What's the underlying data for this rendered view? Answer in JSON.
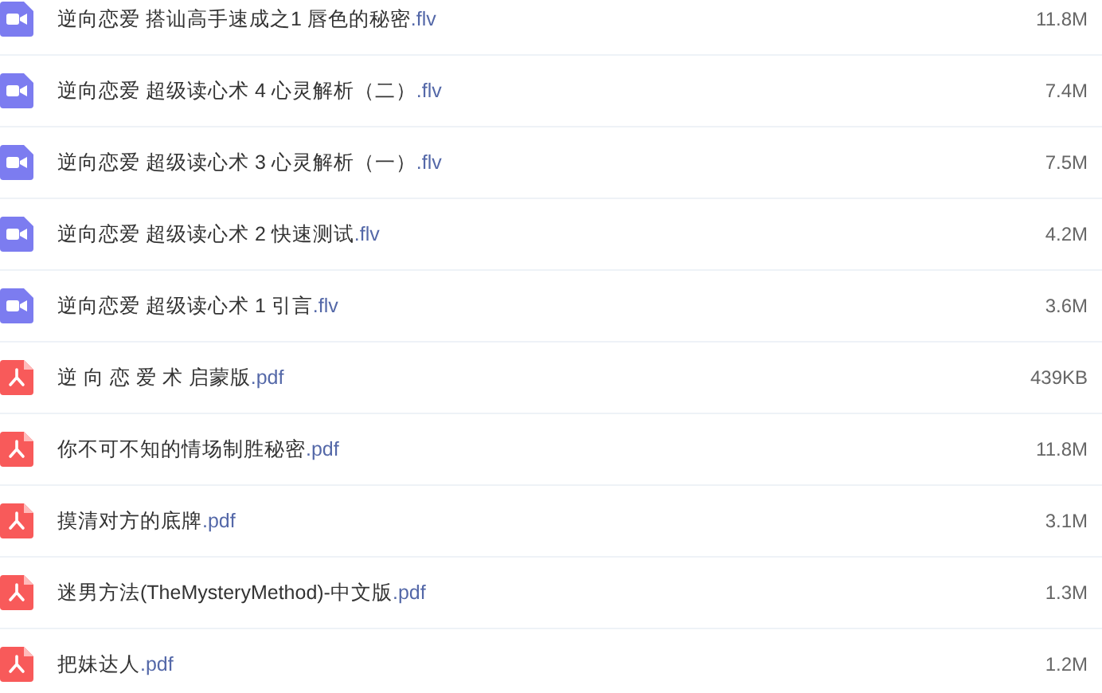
{
  "files": [
    {
      "kind": "video",
      "name": "逆向恋爱 搭讪高手速成之1 唇色的秘密",
      "extension": ".flv",
      "size": "11.8M"
    },
    {
      "kind": "video",
      "name": "逆向恋爱 超级读心术 4 心灵解析（二）",
      "extension": ".flv",
      "size": "7.4M"
    },
    {
      "kind": "video",
      "name": "逆向恋爱 超级读心术 3 心灵解析（一）",
      "extension": ".flv",
      "size": "7.5M"
    },
    {
      "kind": "video",
      "name": "逆向恋爱 超级读心术 2 快速测试",
      "extension": ".flv",
      "size": "4.2M"
    },
    {
      "kind": "video",
      "name": "逆向恋爱 超级读心术 1 引言",
      "extension": ".flv",
      "size": "3.6M"
    },
    {
      "kind": "pdf",
      "name": "逆 向 恋 爱 术 启蒙版",
      "extension": ".pdf",
      "size": "439KB"
    },
    {
      "kind": "pdf",
      "name": "你不可不知的情场制胜秘密",
      "extension": ".pdf",
      "size": "11.8M"
    },
    {
      "kind": "pdf",
      "name": "摸清对方的底牌",
      "extension": ".pdf",
      "size": "3.1M"
    },
    {
      "kind": "pdf",
      "name": "迷男方法(TheMysteryMethod)-中文版",
      "extension": ".pdf",
      "size": "1.3M"
    },
    {
      "kind": "pdf",
      "name": "把妹达人",
      "extension": ".pdf",
      "size": "1.2M"
    }
  ]
}
